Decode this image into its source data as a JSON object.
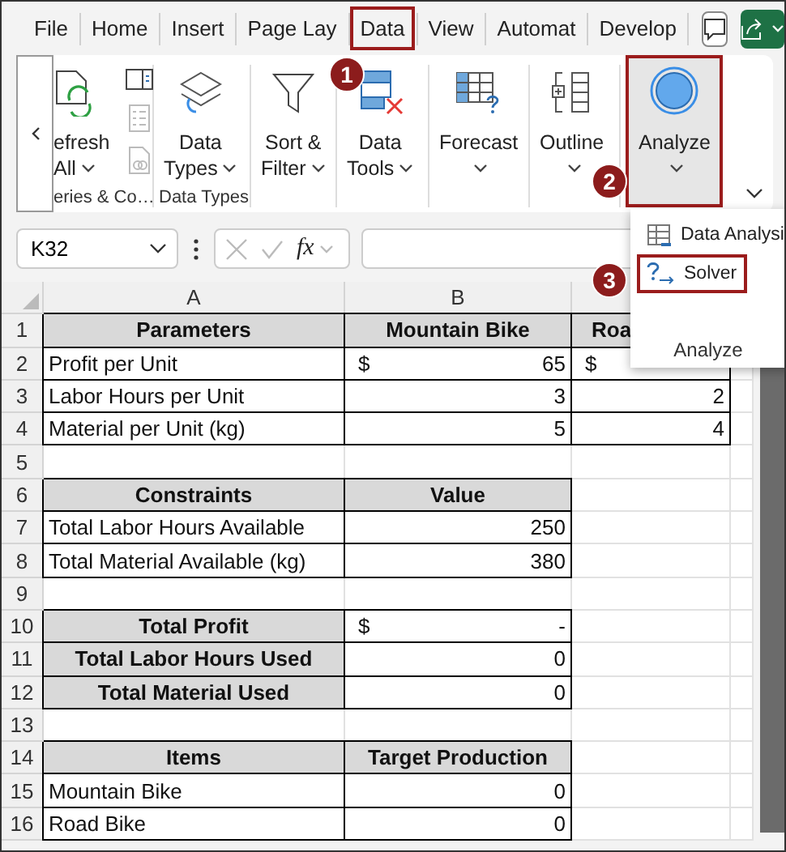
{
  "menu_tabs": [
    {
      "label": "File",
      "selected": false
    },
    {
      "label": "Home",
      "selected": false
    },
    {
      "label": "Insert",
      "selected": false
    },
    {
      "label": "Page Lay",
      "selected": false
    },
    {
      "label": "Data",
      "selected": true
    },
    {
      "label": "View",
      "selected": false
    },
    {
      "label": "Automat",
      "selected": false
    },
    {
      "label": "Develop",
      "selected": false
    }
  ],
  "ribbon": {
    "groups": [
      {
        "kind": "queries",
        "label": "eries & Co…",
        "buttons": [
          {
            "kind": "refresh",
            "lines": [
              "efresh",
              "All"
            ],
            "dropdown": true,
            "selected": false
          }
        ]
      },
      {
        "kind": "data_types",
        "label": "Data Types",
        "buttons": [
          {
            "kind": "data_types",
            "lines": [
              "Data",
              "Types"
            ],
            "dropdown": true,
            "selected": false
          }
        ]
      },
      {
        "kind": "sort_filter",
        "buttons": [
          {
            "kind": "sort_filter",
            "lines": [
              "Sort &",
              "Filter"
            ],
            "dropdown": true,
            "selected": false
          }
        ]
      },
      {
        "kind": "data_tools",
        "buttons": [
          {
            "kind": "data_tools",
            "lines": [
              "Data",
              "Tools"
            ],
            "dropdown": true,
            "selected": false
          }
        ]
      },
      {
        "kind": "forecast",
        "buttons": [
          {
            "kind": "forecast",
            "lines": [
              "Forecast"
            ],
            "dropdown": true,
            "selected": false
          }
        ]
      },
      {
        "kind": "outline",
        "buttons": [
          {
            "kind": "outline",
            "lines": [
              "Outline"
            ],
            "dropdown": true,
            "selected": false
          }
        ]
      },
      {
        "kind": "analyze",
        "buttons": [
          {
            "kind": "analyze",
            "lines": [
              "Analyze"
            ],
            "dropdown": true,
            "selected": true
          }
        ]
      }
    ]
  },
  "analyze_menu": {
    "items": [
      {
        "kind": "data_analysis",
        "label": "Data Analysi",
        "selected": false
      },
      {
        "kind": "solver",
        "label": "Solver",
        "selected": true
      }
    ],
    "label": "Analyze"
  },
  "step_badges": [
    {
      "text": "1"
    },
    {
      "text": "2"
    },
    {
      "text": "3"
    }
  ],
  "formula_bar": {
    "name_box": "K32",
    "fx_label": "fx"
  },
  "sheet": {
    "columns": [
      "A",
      "B"
    ],
    "rows": [
      {
        "number": "1",
        "cells": [
          {
            "kind": "header",
            "text": "Parameters"
          },
          {
            "kind": "header",
            "text": "Mountain Bike"
          },
          {
            "kind": "header_cut",
            "text": "Roa"
          }
        ]
      },
      {
        "number": "2",
        "cells": [
          {
            "kind": "text",
            "text": "Profit per Unit"
          },
          {
            "kind": "currency",
            "symbol": "$",
            "value": "65"
          },
          {
            "kind": "currency",
            "symbol": "$"
          }
        ]
      },
      {
        "number": "3",
        "cells": [
          {
            "kind": "text",
            "text": "Labor Hours per Unit"
          },
          {
            "kind": "number",
            "text": "3"
          },
          {
            "kind": "number",
            "text": "2"
          }
        ]
      },
      {
        "number": "4",
        "cells": [
          {
            "kind": "text",
            "text": "Material per Unit (kg)"
          },
          {
            "kind": "number",
            "text": "5"
          },
          {
            "kind": "number",
            "text": "4"
          }
        ]
      },
      {
        "number": "5",
        "cells": [
          {
            "kind": "empty"
          },
          {
            "kind": "empty"
          },
          {
            "kind": "empty"
          }
        ]
      },
      {
        "number": "6",
        "cells": [
          {
            "kind": "header",
            "text": "Constraints"
          },
          {
            "kind": "header",
            "text": "Value"
          },
          {
            "kind": "empty"
          }
        ]
      },
      {
        "number": "7",
        "cells": [
          {
            "kind": "text",
            "text": "Total Labor Hours Available"
          },
          {
            "kind": "number",
            "text": "250"
          },
          {
            "kind": "empty"
          }
        ]
      },
      {
        "number": "8",
        "cells": [
          {
            "kind": "text",
            "text": "Total Material Available (kg)"
          },
          {
            "kind": "number",
            "text": "380"
          },
          {
            "kind": "empty"
          }
        ]
      },
      {
        "number": "9",
        "cells": [
          {
            "kind": "empty"
          },
          {
            "kind": "empty"
          },
          {
            "kind": "empty"
          }
        ]
      },
      {
        "number": "10",
        "cells": [
          {
            "kind": "header",
            "text": "Total Profit"
          },
          {
            "kind": "currency",
            "symbol": "$",
            "value": "-"
          },
          {
            "kind": "empty"
          }
        ]
      },
      {
        "number": "11",
        "cells": [
          {
            "kind": "header",
            "text": "Total Labor Hours Used"
          },
          {
            "kind": "number",
            "text": "0"
          },
          {
            "kind": "empty"
          }
        ]
      },
      {
        "number": "12",
        "cells": [
          {
            "kind": "header",
            "text": "Total Material Used"
          },
          {
            "kind": "number",
            "text": "0"
          },
          {
            "kind": "empty"
          }
        ]
      },
      {
        "number": "13",
        "cells": [
          {
            "kind": "empty"
          },
          {
            "kind": "empty"
          },
          {
            "kind": "empty"
          }
        ]
      },
      {
        "number": "14",
        "cells": [
          {
            "kind": "header",
            "text": "Items"
          },
          {
            "kind": "header",
            "text": "Target Production"
          },
          {
            "kind": "empty"
          }
        ]
      },
      {
        "number": "15",
        "cells": [
          {
            "kind": "text",
            "text": "Mountain Bike"
          },
          {
            "kind": "number",
            "text": "0"
          },
          {
            "kind": "empty"
          }
        ]
      },
      {
        "number": "16",
        "cells": [
          {
            "kind": "text",
            "text": "Road Bike"
          },
          {
            "kind": "number",
            "text": "0"
          },
          {
            "kind": "empty"
          }
        ]
      }
    ]
  }
}
